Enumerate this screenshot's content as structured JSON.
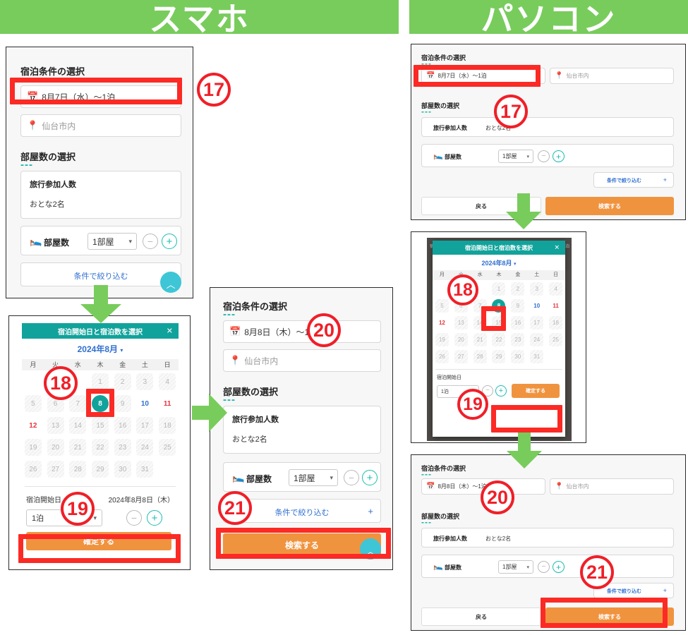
{
  "banners": {
    "smartphone": "スマホ",
    "pc": "パソコン"
  },
  "labels": {
    "stay_conditions_title": "宿泊条件の選択",
    "room_count_title": "部屋数の選択",
    "dashes": "---",
    "travelers_label": "旅行参加人数",
    "travelers_value": "おとな2名",
    "rooms_label": "部屋数",
    "rooms_value": "1部屋",
    "filter_label": "条件で絞り込む",
    "filter_plus": "+",
    "search_button": "検索する",
    "back_button": "戻る",
    "confirm_button": "確定する",
    "location_placeholder": "仙台市内",
    "date_before": "8月7日（水）〜1泊",
    "date_after": "8月8日（木）〜1泊",
    "minus": "－",
    "plus": "＋",
    "caret": "▾",
    "fab": "︿"
  },
  "calendar": {
    "title": "宿泊開始日と宿泊数を選択",
    "close": "✕",
    "month": "2024年8月",
    "month_caret": "▾",
    "dow": [
      "月",
      "火",
      "水",
      "木",
      "金",
      "土",
      "日"
    ],
    "weeks": [
      [
        "",
        "",
        "",
        "1",
        "2",
        "3",
        "4"
      ],
      [
        "5",
        "6",
        "7",
        "8",
        "9",
        "10",
        "11"
      ],
      [
        "12",
        "13",
        "14",
        "15",
        "16",
        "17",
        "18"
      ],
      [
        "19",
        "20",
        "21",
        "22",
        "23",
        "24",
        "25"
      ],
      [
        "26",
        "27",
        "28",
        "29",
        "30",
        "31",
        ""
      ]
    ],
    "selected_day": "8",
    "start_label": "宿泊開始日",
    "start_value": "2024年8月8日（木）",
    "nights_value": "1泊"
  },
  "badges": {
    "b17": "⑰",
    "b18": "⑱",
    "b19": "⑲",
    "b20": "⑳",
    "b21": "㉑"
  },
  "badge_numbers": {
    "n17": "17",
    "n18": "18",
    "n19": "19",
    "n20": "20",
    "n21": "21"
  },
  "colors": {
    "green_banner": "#78cc5c",
    "green_arrow": "#78cc5c",
    "red_highlight": "#fb2a25",
    "teal": "#11a39b",
    "orange": "#f0933f",
    "blue_link": "#2f6fd0"
  }
}
